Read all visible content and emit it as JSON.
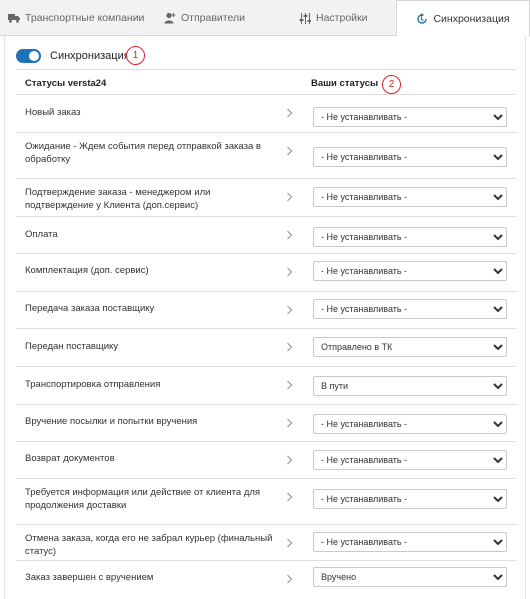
{
  "tabs": [
    {
      "label": "Транспортные компании",
      "icon": "truck-icon"
    },
    {
      "label": "Отправители",
      "icon": "user-icon"
    },
    {
      "label": "Настройки",
      "icon": "sliders-icon"
    },
    {
      "label": "Синхронизация",
      "icon": "sync-icon",
      "active": true
    }
  ],
  "sync": {
    "label": "Синхронизация",
    "enabled": true,
    "badge": "1"
  },
  "table": {
    "left_header": "Статусы versta24",
    "right_header": "Ваши статусы",
    "right_badge": "2",
    "rows": [
      {
        "label": "Новый заказ",
        "value": "- Не устанавливать -"
      },
      {
        "label": "Ожидание - Ждем события перед отправкой заказа в обработку",
        "value": "- Не устанавливать -"
      },
      {
        "label": "Подтверждение заказа - менеджером или подтверждение у Клиента (доп.сервис)",
        "value": "- Не устанавливать -"
      },
      {
        "label": "Оплата",
        "value": "- Не устанавливать -"
      },
      {
        "label": "Комплектация (доп. сервис)",
        "value": "- Не устанавливать -"
      },
      {
        "label": "Передача заказа поставщику",
        "value": "- Не устанавливать -"
      },
      {
        "label": "Передан поставщику",
        "value": "Отправлено в ТК"
      },
      {
        "label": "Транспортировка отправления",
        "value": "В пути"
      },
      {
        "label": "Вручение посылки и попытки вручения",
        "value": "- Не устанавливать -"
      },
      {
        "label": "Возврат документов",
        "value": "- Не устанавливать -"
      },
      {
        "label": "Требуется информация или действие от клиента для продолжения доставки",
        "value": "- Не устанавливать -"
      },
      {
        "label": "Отмена заказа, когда его не забрал курьер (финальный статус)",
        "value": "- Не устанавливать -"
      },
      {
        "label": "Заказ завершен с вручением",
        "value": "Вручено"
      }
    ]
  }
}
